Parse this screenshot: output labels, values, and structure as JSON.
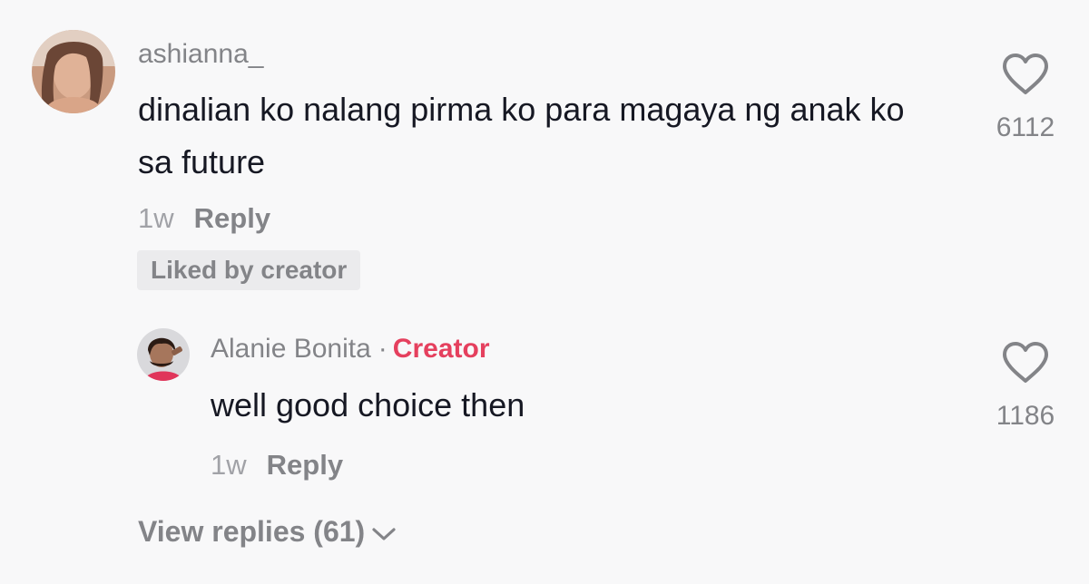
{
  "comments": [
    {
      "username": "ashianna_",
      "text": "dinalian ko nalang pirma ko para magaya ng anak ko sa future",
      "time": "1w",
      "reply_label": "Reply",
      "badge": "Liked by creator",
      "likes": "6112",
      "avatar_icon": "user-avatar"
    }
  ],
  "replies": [
    {
      "username": "Alanie Bonita",
      "separator": "·",
      "creator_label": "Creator",
      "text": "well good choice then",
      "time": "1w",
      "reply_label": "Reply",
      "likes": "1186",
      "avatar_icon": "creator-avatar"
    }
  ],
  "view_replies": {
    "label": "View replies (61)",
    "icon": "chevron-down-icon"
  },
  "colors": {
    "background": "#f8f8f9",
    "primary_text": "#161823",
    "secondary_text": "#838488",
    "creator_accent": "#e5405e",
    "badge_bg": "#ebebed"
  }
}
